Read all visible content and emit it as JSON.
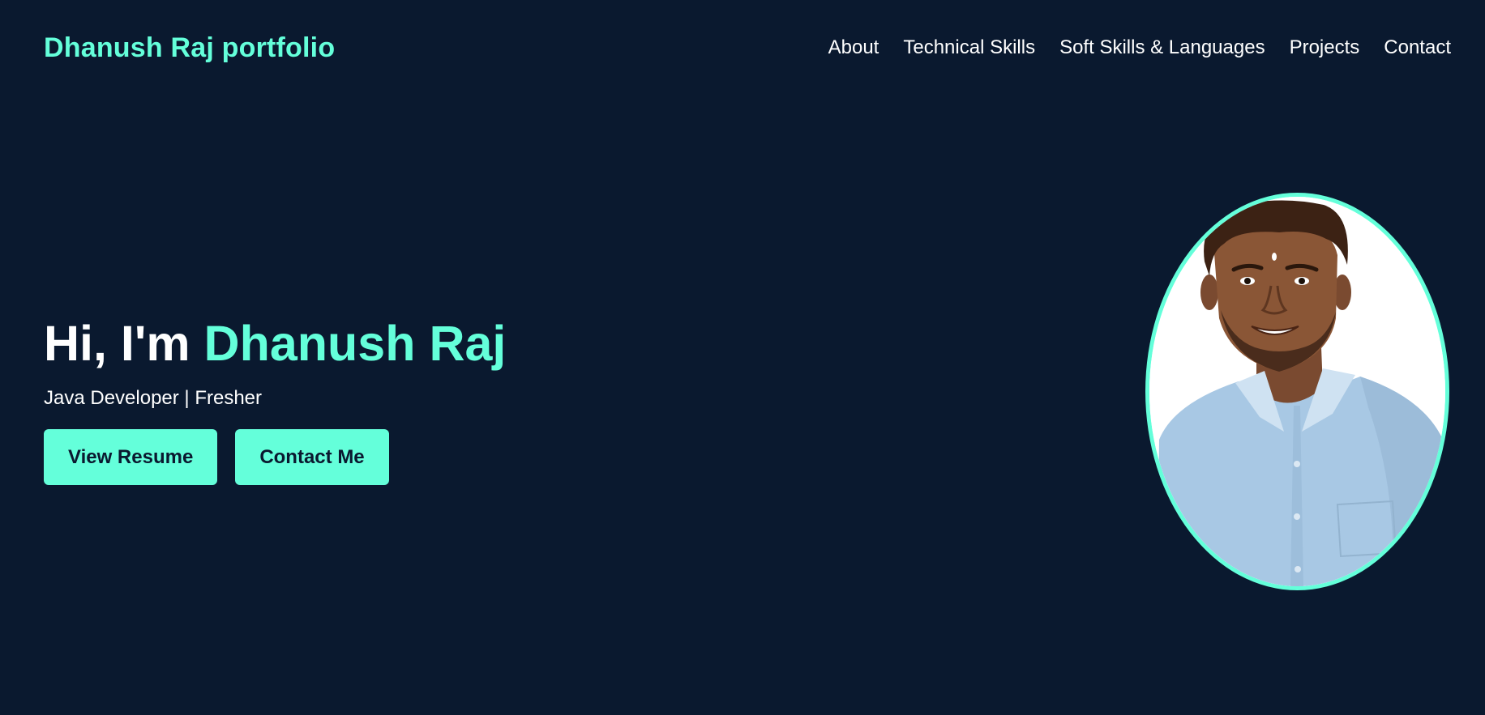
{
  "header": {
    "brand": "Dhanush Raj portfolio",
    "nav": [
      {
        "label": "About"
      },
      {
        "label": "Technical Skills"
      },
      {
        "label": "Soft Skills & Languages"
      },
      {
        "label": "Projects"
      },
      {
        "label": "Contact"
      }
    ]
  },
  "hero": {
    "greeting": "Hi, I'm ",
    "name": "Dhanush Raj",
    "subtitle": "Java Developer | Fresher",
    "buttons": {
      "resume": "View Resume",
      "contact": "Contact Me"
    }
  },
  "profile_photo": {
    "subject": "portrait of a young man in a light blue collared shirt"
  },
  "colors": {
    "background": "#0a192f",
    "accent": "#64ffda",
    "text": "#ffffff"
  }
}
